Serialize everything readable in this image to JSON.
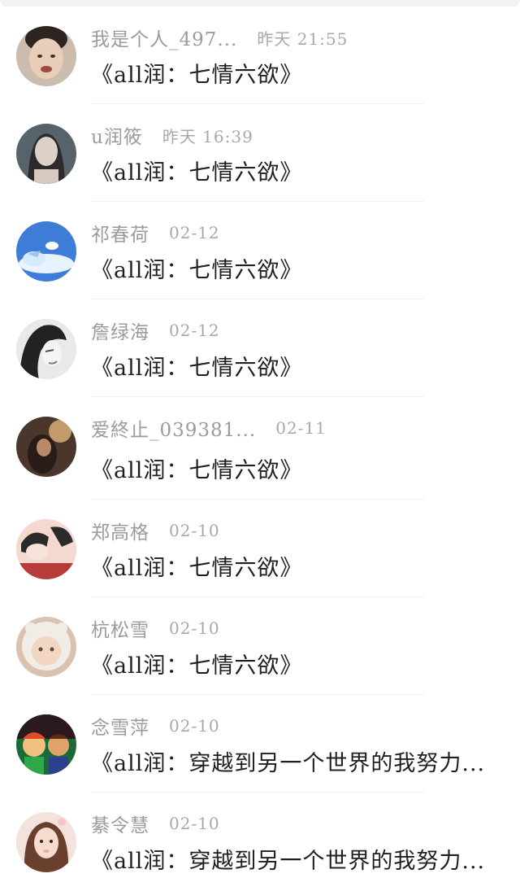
{
  "comments": [
    {
      "name": "我是个人_497...",
      "time": "昨天 21:55",
      "title": "《all润：七情六欲》",
      "avatar_icon": "boy-photo-avatar",
      "avatar_colors": [
        "#c7b7a7",
        "#3a2e28",
        "#e8cdb8"
      ]
    },
    {
      "name": "u润筱",
      "time": "昨天 16:39",
      "title": "《all润：七情六欲》",
      "avatar_icon": "girl-portrait-avatar",
      "avatar_colors": [
        "#4e5b63",
        "#d6c9c0",
        "#2c2a2b"
      ]
    },
    {
      "name": "祁春荷",
      "time": "02-12",
      "title": "《all润：七情六欲》",
      "avatar_icon": "sky-cloud-avatar",
      "avatar_colors": [
        "#3d7dd8",
        "#e9f2ff",
        "#9cc3f0"
      ]
    },
    {
      "name": "詹绿海",
      "time": "02-12",
      "title": "《all润：七情六欲》",
      "avatar_icon": "sketch-portrait-avatar",
      "avatar_colors": [
        "#e7e7e7",
        "#222222",
        "#7a7a7a"
      ]
    },
    {
      "name": "爱終止_039381...",
      "time": "02-11",
      "title": "《all润：七情六欲》",
      "avatar_icon": "dark-photo-avatar",
      "avatar_colors": [
        "#3b2a22",
        "#c49a6a",
        "#7a5a44"
      ]
    },
    {
      "name": "郑高格",
      "time": "02-10",
      "title": "《all润：七情六欲》",
      "avatar_icon": "illustration-couple-avatar",
      "avatar_colors": [
        "#f3d9cf",
        "#b53c3a",
        "#2b2b2b"
      ]
    },
    {
      "name": "杭松雪",
      "time": "02-10",
      "title": "《all润：七情六欲》",
      "avatar_icon": "baby-photo-avatar",
      "avatar_colors": [
        "#f2ece6",
        "#d9c3b0",
        "#5a4a42"
      ]
    },
    {
      "name": "念雪萍",
      "time": "02-10",
      "title": "《all润：穿越到另一个世界的我努力...",
      "avatar_icon": "cartoon-characters-avatar",
      "avatar_colors": [
        "#1b6a3a",
        "#e34a2a",
        "#2d3f8f"
      ]
    },
    {
      "name": "綦令慧",
      "time": "02-10",
      "title": "《all润：穿越到另一个世界的我努力...",
      "avatar_icon": "girl-photo-avatar",
      "avatar_colors": [
        "#f4e3dc",
        "#6b3f2e",
        "#e6b0a6"
      ]
    }
  ]
}
